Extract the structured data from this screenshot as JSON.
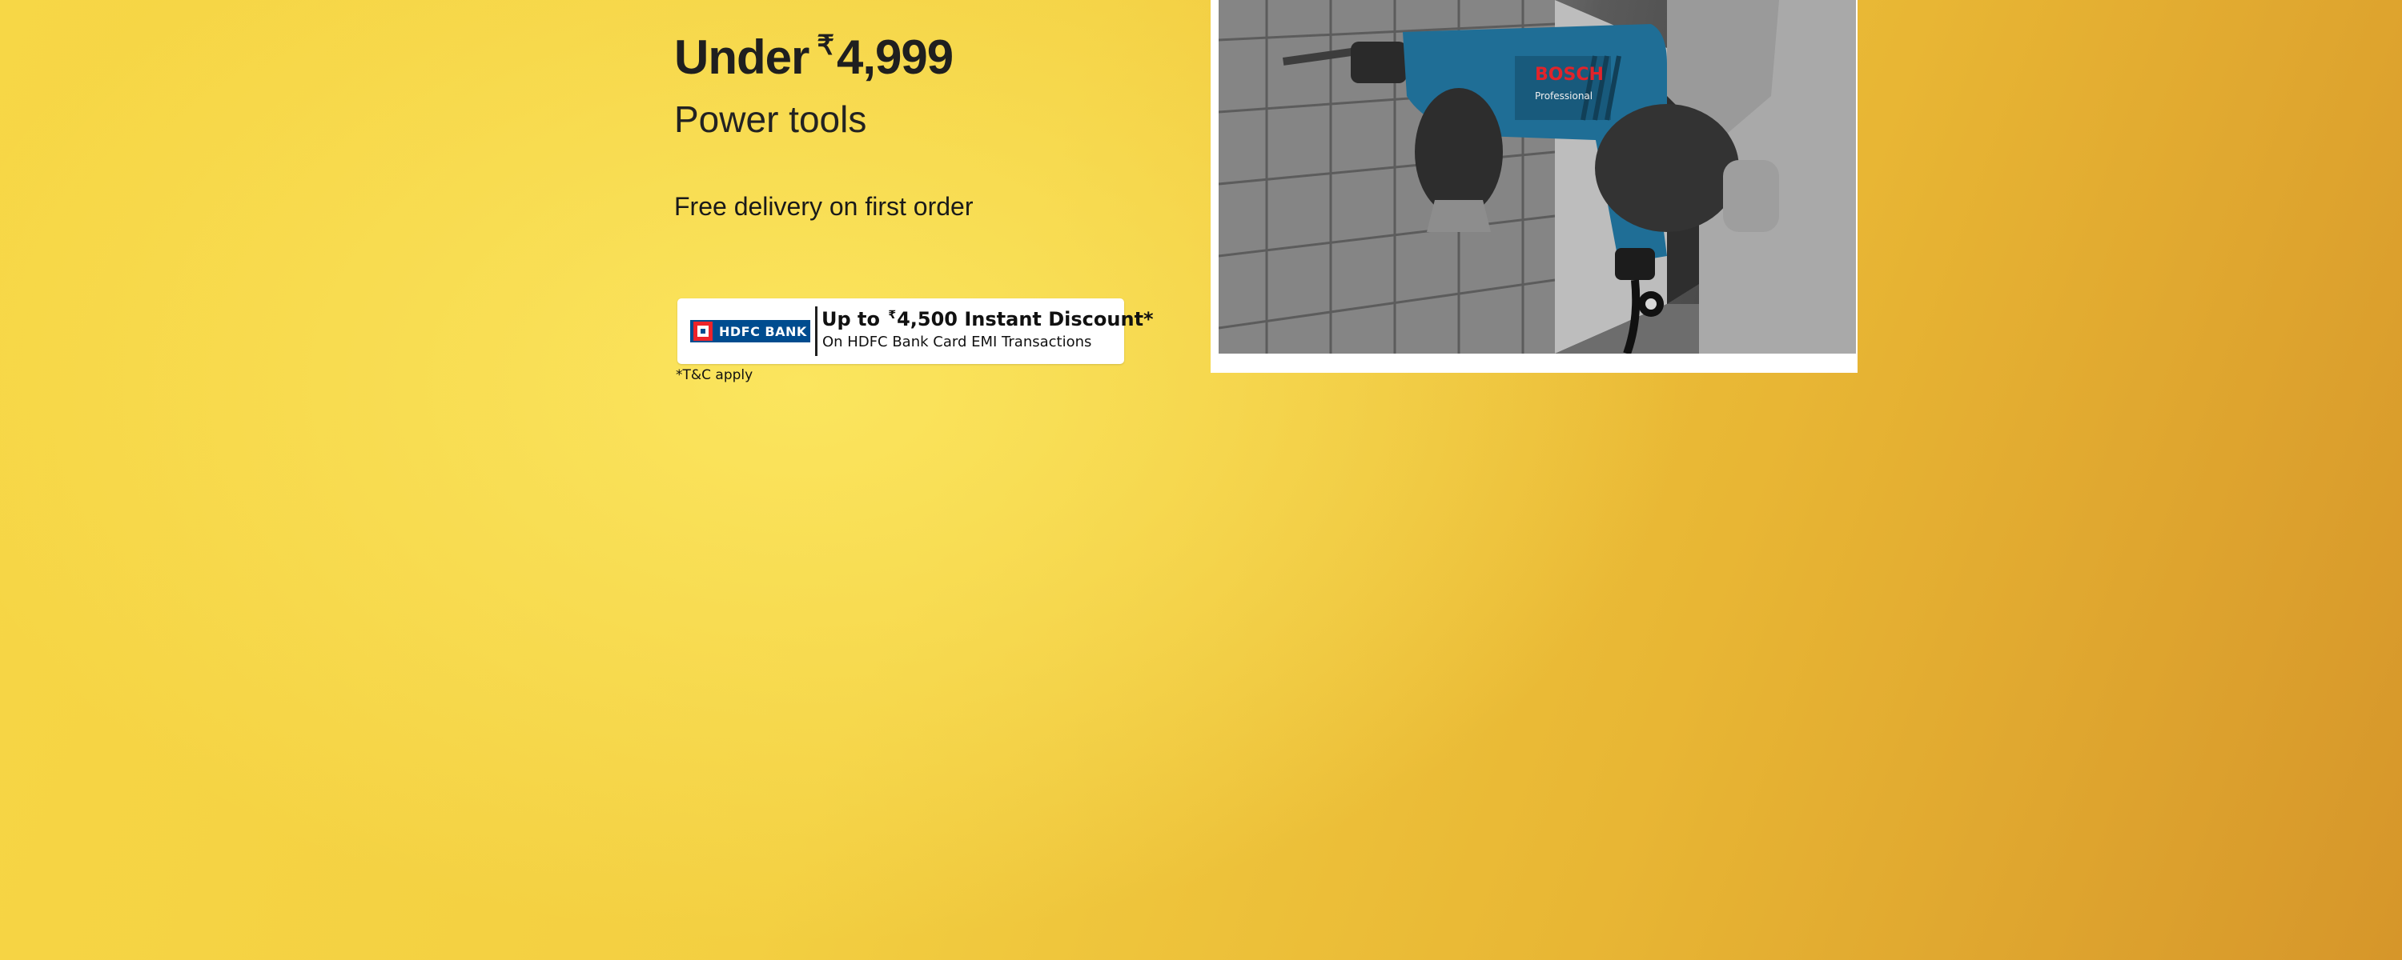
{
  "banner": {
    "headline_prefix": "Under",
    "currency_symbol": "₹",
    "headline_amount": "4,999",
    "subheading": "Power tools",
    "delivery_text": "Free delivery on first order",
    "tnc": "*T&C apply"
  },
  "offer": {
    "bank_name": "HDFC BANK",
    "title_prefix": "Up to",
    "currency_symbol": "₹",
    "title_amount": "4,500 Instant Discount*",
    "subtitle": "On HDFC Bank Card EMI Transactions"
  },
  "photo": {
    "drill_brand": "BOSCH",
    "drill_label": "Professional"
  },
  "colors": {
    "background_yellow": "#f7d746",
    "hdfc_blue": "#004c8f",
    "hdfc_red": "#ed232a",
    "drill_blue": "#1f6e96"
  }
}
